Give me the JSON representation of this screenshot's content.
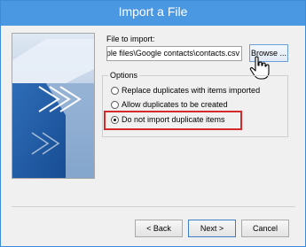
{
  "window": {
    "title": "Import a File"
  },
  "file_import": {
    "label": "File to import:",
    "path_value": "mple files\\Google contacts\\contacts.csv",
    "browse_label": "Browse ..."
  },
  "options": {
    "legend": "Options",
    "items": [
      {
        "label": "Replace duplicates with items imported",
        "checked": false
      },
      {
        "label": "Allow duplicates to be created",
        "checked": false
      },
      {
        "label": "Do not import duplicate items",
        "checked": true
      }
    ],
    "highlight_color": "#d42a2a"
  },
  "footer": {
    "back_label": "< Back",
    "next_label": "Next >",
    "cancel_label": "Cancel"
  },
  "colors": {
    "titlebar": "#4a97e2",
    "accent": "#2e6fb8"
  }
}
